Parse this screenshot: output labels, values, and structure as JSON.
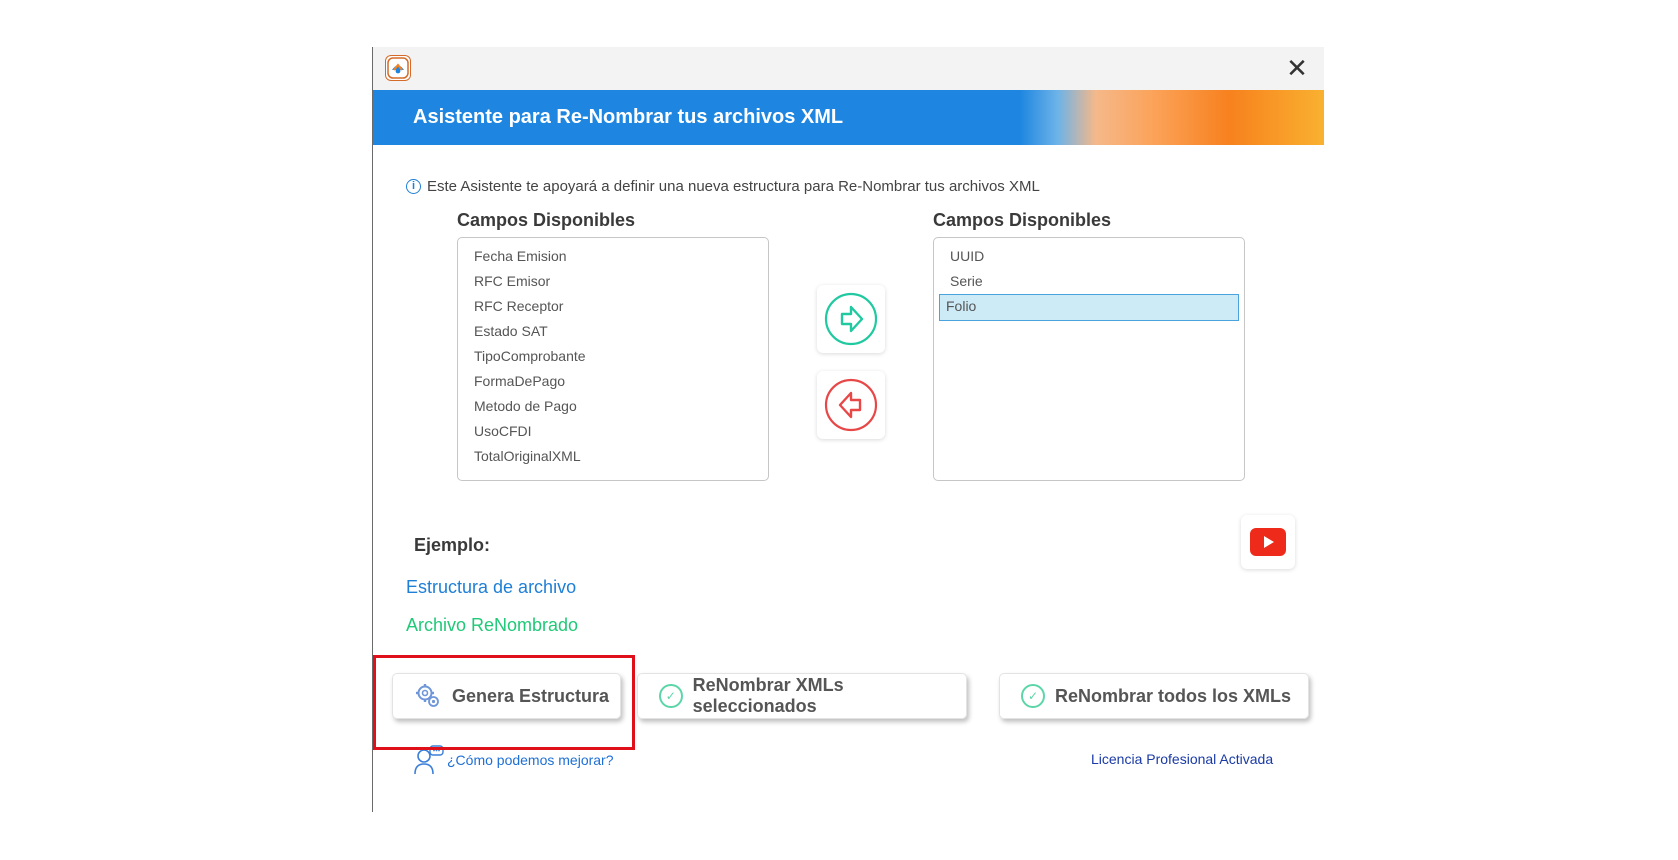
{
  "window": {
    "close_symbol": "✕",
    "header_title": "Asistente para Re-Nombrar tus archivos XML"
  },
  "info": {
    "icon": "info-icon",
    "text": "Este Asistente te apoyará a definir una nueva estructura para Re-Nombrar tus archivos XML"
  },
  "available_fields": {
    "title": "Campos Disponibles",
    "items": [
      "Fecha Emision",
      "RFC Emisor",
      "RFC Receptor",
      "Estado SAT",
      "TipoComprobante",
      "FormaDePago",
      "Metodo de Pago",
      "UsoCFDI",
      "TotalOriginalXML"
    ]
  },
  "selected_fields": {
    "title": "Campos Disponibles",
    "items": [
      "UUID",
      "Serie",
      "Folio"
    ],
    "selected_item": "Folio"
  },
  "example": {
    "label": "Ejemplo:",
    "structure_text": "Estructura de archivo",
    "renamed_text": "Archivo ReNombrado"
  },
  "actions": {
    "generate": "Genera Estructura",
    "rename_selected": "ReNombrar XMLs seleccionados",
    "rename_all": "ReNombrar todos los XMLs"
  },
  "footer": {
    "feedback": "¿Cómo podemos mejorar?",
    "license": "Licencia Profesional Activada"
  },
  "colors": {
    "accent_blue": "#1e86e0",
    "accent_orange": "#f7811e",
    "green": "#20c978",
    "red": "#e84747",
    "highlight": "#e0101a"
  }
}
